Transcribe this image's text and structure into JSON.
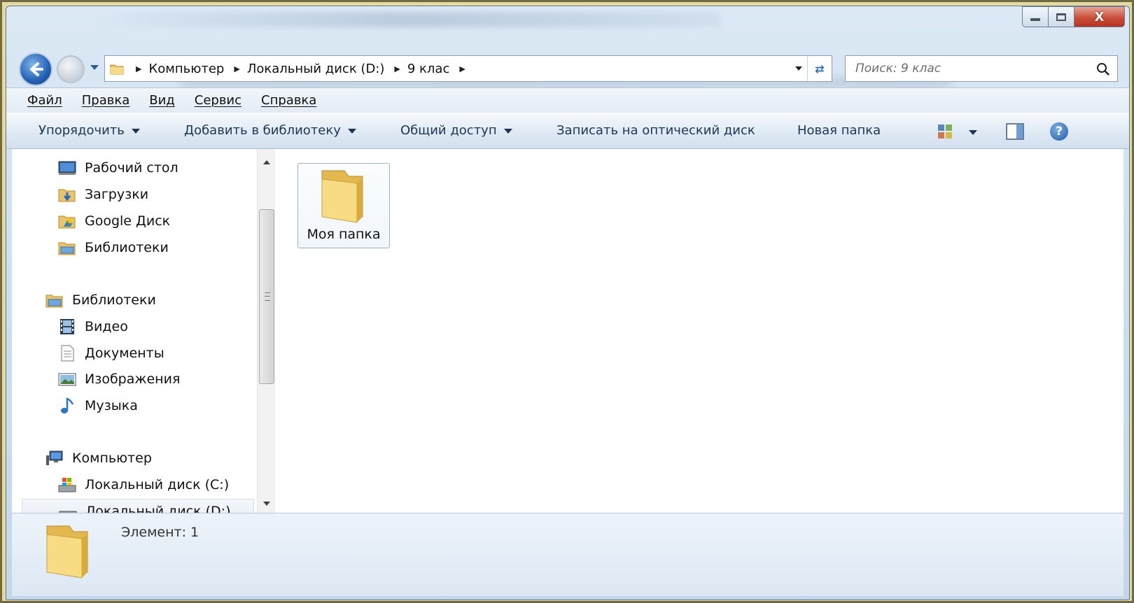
{
  "window": {
    "caption_buttons": {
      "close_label": "X"
    }
  },
  "address": {
    "crumbs": [
      "Компьютер",
      "Локальный диск (D:)",
      "9 клас"
    ]
  },
  "search": {
    "placeholder": "Поиск: 9 клас"
  },
  "menu": [
    "Файл",
    "Правка",
    "Вид",
    "Сервис",
    "Справка"
  ],
  "commands": {
    "organize": "Упорядочить",
    "add_library": "Добавить в библиотеку",
    "share": "Общий доступ",
    "burn": "Записать на оптический диск",
    "new_folder": "Новая папка",
    "help": "?"
  },
  "nav": {
    "favorites": [
      "Рабочий стол",
      "Загрузки",
      "Google Диск",
      "Библиотеки"
    ],
    "libraries_header": "Библиотеки",
    "libraries": [
      "Видео",
      "Документы",
      "Изображения",
      "Музыка"
    ],
    "computer_header": "Компьютер",
    "drives": [
      "Локальный диск (C:)",
      "Локальный диск (D:)"
    ]
  },
  "files": [
    {
      "name": "Моя папка",
      "type": "folder-icon"
    }
  ],
  "status": {
    "text": "Элемент: 1"
  },
  "colors": {
    "accent": "#2361b5",
    "frame": "#e6d9a0",
    "close": "#c9503b"
  }
}
